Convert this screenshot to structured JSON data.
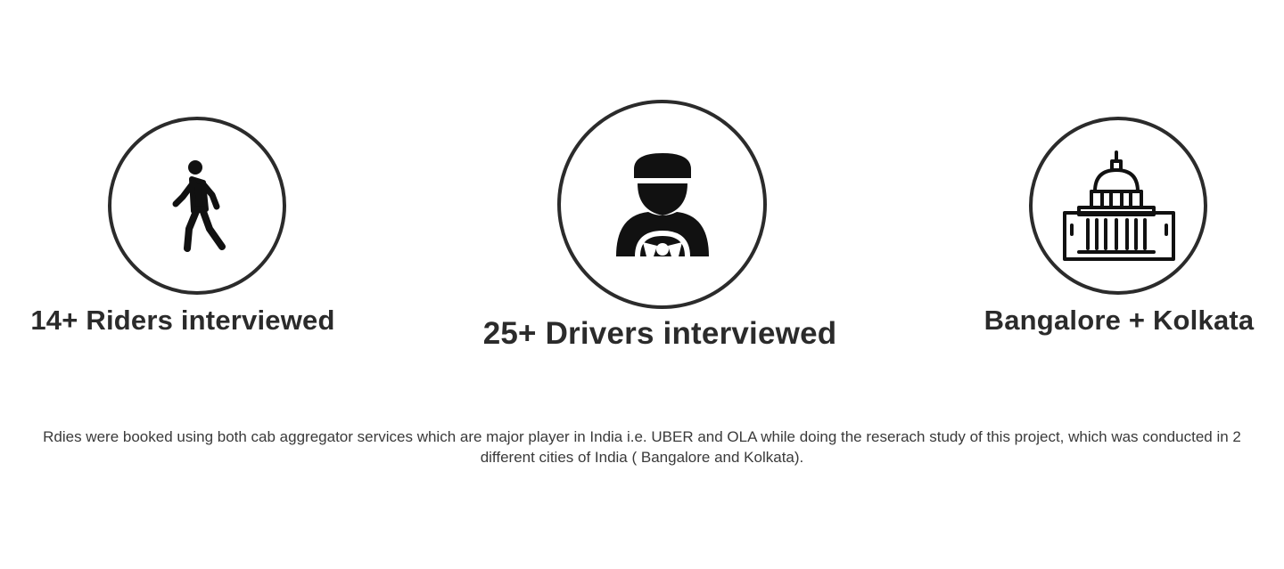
{
  "stats": [
    {
      "label": "14+ Riders interviewed",
      "icon": "walking-person-icon"
    },
    {
      "label": "25+ Drivers interviewed",
      "icon": "driver-steering-wheel-icon"
    },
    {
      "label": "Bangalore + Kolkata",
      "icon": "capitol-building-icon"
    }
  ],
  "description": "Rdies were booked using both cab aggregator services which are major player in India i.e. UBER and OLA while doing the reserach study of this project, which was conducted in 2 different cities of India ( Bangalore and Kolkata).",
  "colors": {
    "text": "#2b2b2b",
    "icon": "#111111",
    "background": "#ffffff"
  }
}
